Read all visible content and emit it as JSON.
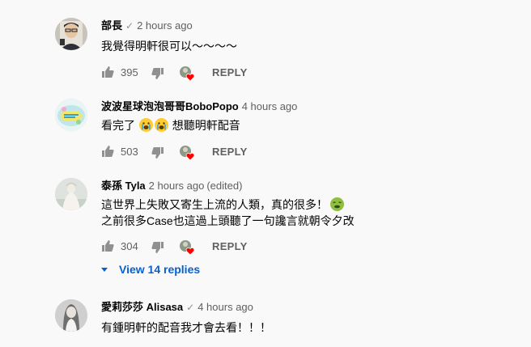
{
  "comments": [
    {
      "author": "部長",
      "verified": "✓",
      "time": "2 hours ago",
      "edited": "",
      "lines": [
        "我覺得明軒很可以～～～～"
      ],
      "likes": "395",
      "reply_label": "REPLY"
    },
    {
      "author": "波波星球泡泡哥哥BoboPopo",
      "verified": "",
      "time": "4 hours ago",
      "edited": "",
      "lines": [
        "看完了",
        "想聽明軒配音"
      ],
      "likes": "503",
      "reply_label": "REPLY"
    },
    {
      "author": "泰孫 Tyla",
      "verified": "",
      "time": "2 hours ago",
      "edited": "(edited)",
      "lines": [
        "這世界上失敗又寄生上流的人類，真的很多！",
        "之前很多Case也這過上頭聽了一句讒言就朝令夕改"
      ],
      "likes": "304",
      "reply_label": "REPLY",
      "view_replies": "View 14 replies"
    },
    {
      "author": "愛莉莎莎 Alisasa",
      "verified": "✓",
      "time": "4 hours ago",
      "edited": "",
      "lines": [
        "有鍾明軒的配音我才會去看！！！"
      ]
    }
  ],
  "icons": {
    "like": "thumbs-up-icon",
    "dislike": "thumbs-down-icon",
    "hearted": "creator-heart-icon",
    "verified": "verified-check-icon",
    "expand": "caret-down-icon"
  },
  "colors": {
    "link": "#065fd4",
    "heart": "#ff0000",
    "secondary_text": "#606060"
  }
}
